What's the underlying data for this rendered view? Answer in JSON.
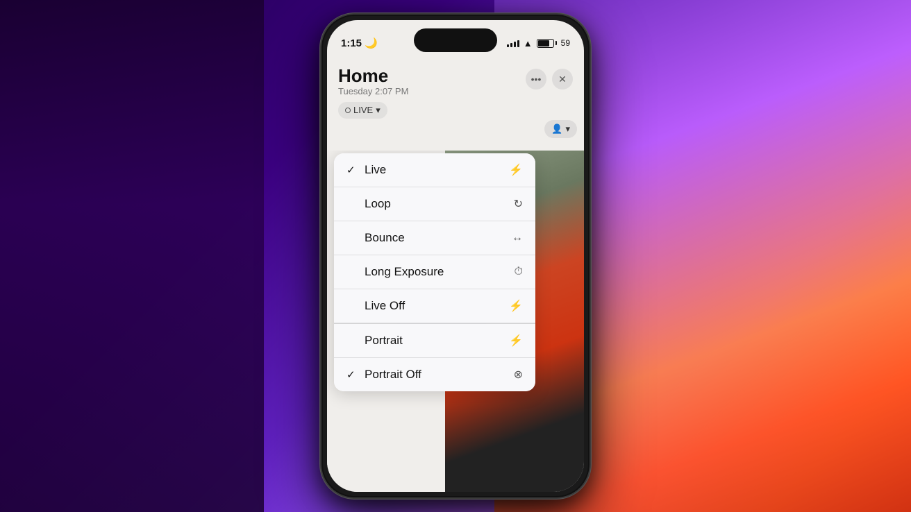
{
  "background": {
    "description": "blurred room background with colorful lighting"
  },
  "phone": {
    "status_bar": {
      "time": "1:15",
      "moon": "🌙",
      "signal_bars": [
        4,
        6,
        8,
        10,
        12
      ],
      "wifi": "WiFi",
      "battery_percent": "59"
    },
    "header": {
      "title": "Home",
      "subtitle": "Tuesday  2:07 PM",
      "live_badge_label": "LIVE",
      "more_btn": "•••",
      "close_btn": "×",
      "people_btn": "👥"
    },
    "dropdown": {
      "items": [
        {
          "id": "live",
          "label": "Live",
          "checked": true,
          "icon": "⚡"
        },
        {
          "id": "loop",
          "label": "Loop",
          "checked": false,
          "icon": "↻"
        },
        {
          "id": "bounce",
          "label": "Bounce",
          "checked": false,
          "icon": "↔"
        },
        {
          "id": "long-exposure",
          "label": "Long Exposure",
          "checked": false,
          "icon": "⏱"
        },
        {
          "id": "live-off",
          "label": "Live Off",
          "checked": false,
          "icon": "⚡̶",
          "separator": false
        },
        {
          "id": "portrait",
          "label": "Portrait",
          "checked": false,
          "icon": "⚡",
          "separator": true
        },
        {
          "id": "portrait-off",
          "label": "Portrait Off",
          "checked": true,
          "icon": "⊗",
          "separator": false
        }
      ]
    }
  }
}
